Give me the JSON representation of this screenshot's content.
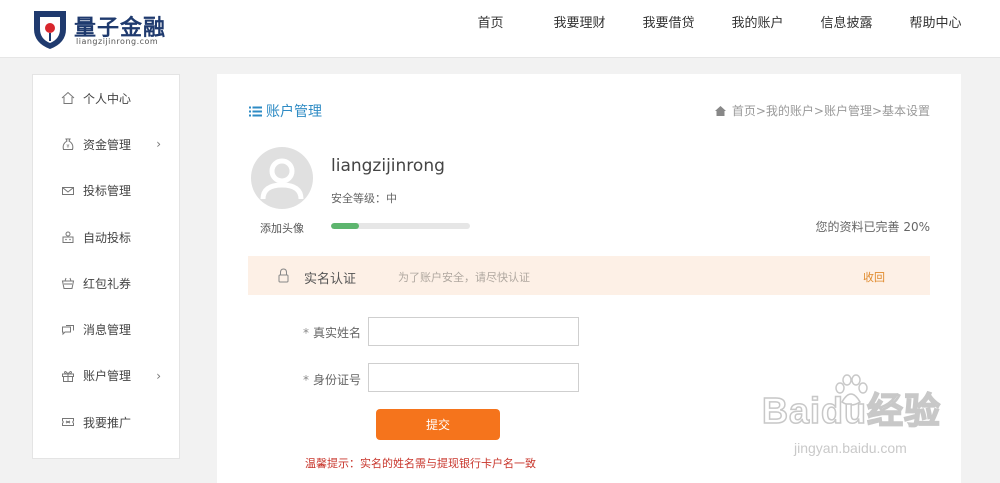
{
  "header": {
    "logo_name": "量子金融",
    "logo_domain": "liangzijinrong.com",
    "nav": [
      "首页",
      "我要理财",
      "我要借贷",
      "我的账户",
      "信息披露",
      "帮助中心"
    ]
  },
  "sidebar": {
    "items": [
      {
        "label": "个人中心",
        "icon": "home-icon",
        "has_arrow": false
      },
      {
        "label": "资金管理",
        "icon": "money-bag-icon",
        "has_arrow": true
      },
      {
        "label": "投标管理",
        "icon": "envelope-icon",
        "has_arrow": false
      },
      {
        "label": "自动投标",
        "icon": "robot-icon",
        "has_arrow": false
      },
      {
        "label": "红包礼券",
        "icon": "gift-basket-icon",
        "has_arrow": false
      },
      {
        "label": "消息管理",
        "icon": "message-icon",
        "has_arrow": false
      },
      {
        "label": "账户管理",
        "icon": "gift-box-icon",
        "has_arrow": true
      },
      {
        "label": "我要推广",
        "icon": "ticket-icon",
        "has_arrow": false
      }
    ],
    "arrow_glyph": "›"
  },
  "main": {
    "title": "账户管理",
    "breadcrumb": "首页>我的账户>账户管理>基本设置",
    "avatar_caption": "添加头像",
    "username": "liangzijinrong",
    "security_level": "安全等级：中",
    "progress_fraction": 0.2,
    "completion_text": "您的资料已完善 20%",
    "verify": {
      "title": "实名认证",
      "tip": "为了账户安全，请尽快认证",
      "collapse": "收回"
    },
    "form": {
      "required_mark": "*",
      "name_label": "真实姓名",
      "name_value": "",
      "id_label": "身份证号",
      "id_value": "",
      "submit": "提交"
    },
    "warm_tip": "温馨提示：实名的姓名需与提现银行卡户名一致"
  },
  "watermark": {
    "brand": "Baidu经验",
    "url": "jingyan.baidu.com"
  },
  "colors": {
    "accent_blue": "#2e8bc4",
    "submit_orange": "#f5741c",
    "progress_green": "#5db56e",
    "verify_bg": "#fdf0e6",
    "warning_red": "#c8352b"
  }
}
